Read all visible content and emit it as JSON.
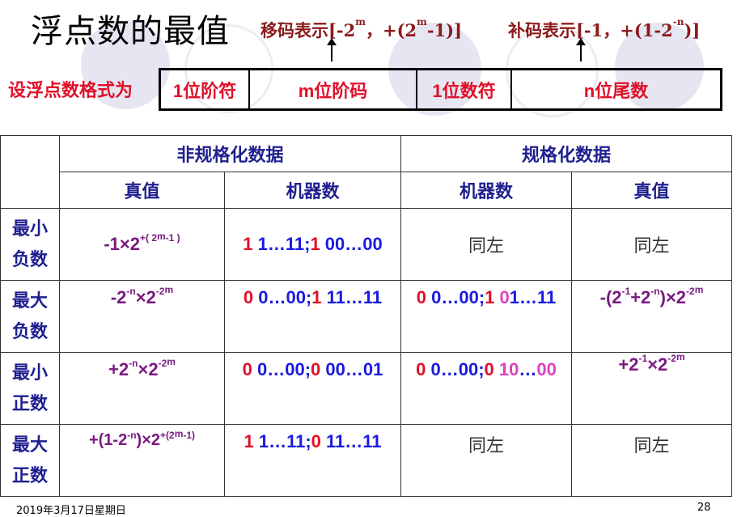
{
  "title": "浮点数的最值",
  "bias_code": {
    "prefix": "移码表示[-2",
    "sup1": "m",
    "mid": "，+(2",
    "sup2": "m",
    "suffix": "-1)]"
  },
  "complement_code": {
    "prefix": "补码表示[-1，+(1-2",
    "sup": "-n",
    "suffix": ")]"
  },
  "format_label": "设浮点数格式为",
  "format_fields": [
    "1位阶符",
    "m位阶码",
    "1位数符",
    "n位尾数"
  ],
  "table": {
    "group_headers": [
      "非规格化数据",
      "规格化数据"
    ],
    "sub_headers": [
      "真值",
      "机器数",
      "机器数",
      "真值"
    ],
    "rows": [
      {
        "label_line1": "最小",
        "label_line2": "负数",
        "col1": {
          "a": "-1×2",
          "sup": "+( 2",
          "sup2": "m",
          "sup3": "-1 )"
        },
        "col2": [
          [
            "1",
            "r"
          ],
          [
            " 1…11;",
            "b"
          ],
          [
            "1",
            "r"
          ],
          [
            " 00…00",
            "b"
          ]
        ],
        "col3": "同左",
        "col4": "同左"
      },
      {
        "label_line1": "最大",
        "label_line2": "负数",
        "col1": {
          "a": "-2",
          "sup": "-n",
          "b": "×2",
          "sup2": "-2",
          "sup3": "m"
        },
        "col2": [
          [
            "0",
            "r"
          ],
          [
            " 0…00;",
            "b"
          ],
          [
            "1",
            "r"
          ],
          [
            " 11…11",
            "b"
          ]
        ],
        "col3": [
          [
            "0",
            "r"
          ],
          [
            " 0…00;",
            "b"
          ],
          [
            "1",
            "r"
          ],
          [
            " ",
            "b"
          ],
          [
            "0",
            "p"
          ],
          [
            "1…11",
            "b"
          ]
        ],
        "col4": {
          "a": "-(2",
          "sup": "-1",
          "b": "+2",
          "sup2": "-n",
          "c": ")×2",
          "sup3": "-2",
          "sup4": "m"
        }
      },
      {
        "label_line1": "最小",
        "label_line2": "正数",
        "col1": {
          "a": "+2",
          "sup": "-n",
          "b": "×2",
          "sup2": "-2",
          "sup3": "m"
        },
        "col2": [
          [
            "0",
            "r"
          ],
          [
            " 0…00;",
            "b"
          ],
          [
            "0",
            "r"
          ],
          [
            " 00…01",
            "b"
          ]
        ],
        "col3": [
          [
            "0",
            "r"
          ],
          [
            " 0…00;",
            "b"
          ],
          [
            "0",
            "r"
          ],
          [
            " ",
            "b"
          ],
          [
            "10",
            "p"
          ],
          [
            "…",
            "b"
          ],
          [
            "00",
            "p"
          ]
        ],
        "col4": {
          "a": "+2",
          "sup": "-1",
          "b": "×2",
          "sup2": "-2",
          "sup3": "m"
        }
      },
      {
        "label_line1": "最大",
        "label_line2": "正数",
        "col1": {
          "a": "+(1-2",
          "sup": "-n",
          "b": ")×2",
          "sup2": "+(2",
          "sup3": "m",
          "sup4": "-1)"
        },
        "col2": [
          [
            "1",
            "r"
          ],
          [
            " 1…11;",
            "b"
          ],
          [
            "0",
            "r"
          ],
          [
            " 11…11",
            "b"
          ]
        ],
        "col3": "同左",
        "col4": "同左"
      }
    ]
  },
  "footer": {
    "date": "2019年3月17日星期日",
    "page": "28"
  },
  "colors": {
    "red": "#e0102a",
    "blue": "#1a1ae0",
    "purple": "#7a1a80",
    "pink": "#e040c0",
    "darkred": "#8b1a1a",
    "navy": "#1f1f8f"
  }
}
